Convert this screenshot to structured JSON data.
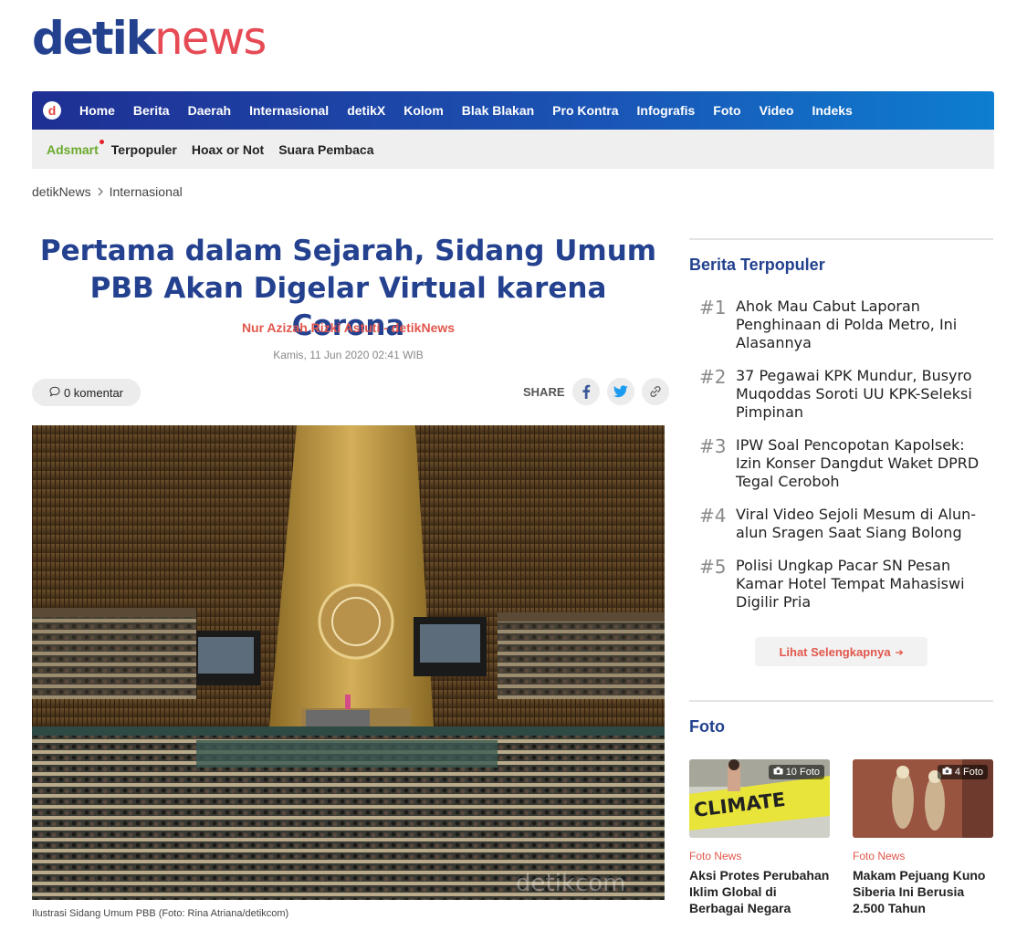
{
  "logo": {
    "part1": "detik",
    "part2": "news"
  },
  "topnav": {
    "logo_letter": "d",
    "items": [
      "Home",
      "Berita",
      "Daerah",
      "Internasional",
      "detikX",
      "Kolom",
      "Blak Blakan",
      "Pro Kontra",
      "Infografis",
      "Foto",
      "Video",
      "Indeks"
    ]
  },
  "subnav": {
    "items": [
      "Adsmart",
      "Terpopuler",
      "Hoax or Not",
      "Suara Pembaca"
    ]
  },
  "breadcrumb": {
    "home": "detikNews",
    "section": "Internasional"
  },
  "article": {
    "title": "Pertama dalam Sejarah, Sidang Umum PBB Akan Digelar Virtual karena Corona",
    "author": "Nur Azizah Rizki Astuti - detikNews",
    "date": "Kamis, 11 Jun 2020 02:41 WIB",
    "comments": "0 komentar",
    "share_label": "SHARE",
    "photo_watermark": "detikcom",
    "caption": "Ilustrasi Sidang Umum PBB (Foto: Rina Atriana/detikcom)"
  },
  "sidebar": {
    "popular_heading": "Berita Terpopuler",
    "popular": [
      {
        "num": "#1",
        "title": "Ahok Mau Cabut Laporan Penghinaan di Polda Metro, Ini Alasannya"
      },
      {
        "num": "#2",
        "title": "37 Pegawai KPK Mundur, Busyro Muqoddas Soroti UU KPK-Seleksi Pimpinan"
      },
      {
        "num": "#3",
        "title": "IPW Soal Pencopotan Kapolsek: Izin Konser Dangdut Waket DPRD Tegal Ceroboh"
      },
      {
        "num": "#4",
        "title": "Viral Video Sejoli Mesum di Alun-alun Sragen Saat Siang Bolong"
      },
      {
        "num": "#5",
        "title": "Polisi Ungkap Pacar SN Pesan Kamar Hotel Tempat Mahasiswi Digilir Pria"
      }
    ],
    "more_label": "Lihat Selengkapnya",
    "foto_heading": "Foto",
    "fotos": [
      {
        "badge": "10 Foto",
        "category": "Foto News",
        "title": "Aksi Protes Perubahan Iklim Global di Berbagai Negara",
        "sign": "CLIMATE"
      },
      {
        "badge": "4 Foto",
        "category": "Foto News",
        "title": "Makam Pejuang Kuno Siberia Ini Berusia 2.500 Tahun"
      }
    ]
  },
  "colors": {
    "brand_blue": "#23418f",
    "accent_red": "#e2574c",
    "adsmart_green": "#6aaa2c"
  }
}
